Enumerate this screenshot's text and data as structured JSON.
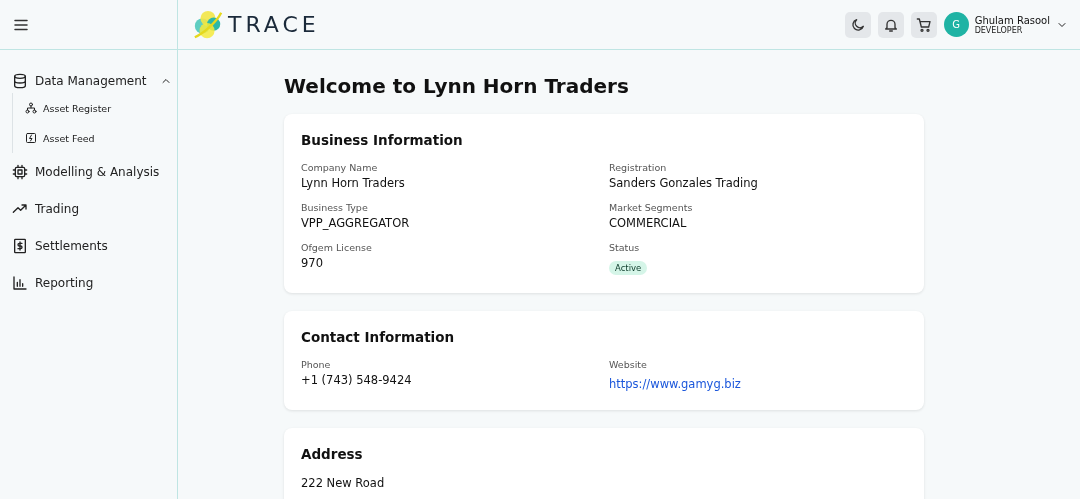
{
  "header": {
    "logo_text": "TRACE",
    "user": {
      "initial": "G",
      "name": "Ghulam Rasool",
      "role": "DEVELOPER"
    }
  },
  "sidebar": {
    "items": [
      {
        "label": "Data Management",
        "expanded": true,
        "children": [
          {
            "label": "Asset Register"
          },
          {
            "label": "Asset Feed"
          }
        ]
      },
      {
        "label": "Modelling & Analysis"
      },
      {
        "label": "Trading"
      },
      {
        "label": "Settlements"
      },
      {
        "label": "Reporting"
      }
    ]
  },
  "page_title": "Welcome to Lynn Horn Traders",
  "cards": [
    {
      "title": "Business Information",
      "fields": [
        {
          "label": "Company Name",
          "value": "Lynn Horn Traders",
          "kind": "text"
        },
        {
          "label": "Registration",
          "value": "Sanders Gonzales Trading",
          "kind": "text"
        },
        {
          "label": "Business Type",
          "value": "VPP_AGGREGATOR",
          "kind": "text"
        },
        {
          "label": "Market Segments",
          "value": "COMMERCIAL",
          "kind": "text"
        },
        {
          "label": "Ofgem License",
          "value": "970",
          "kind": "text"
        },
        {
          "label": "Status",
          "value": "Active",
          "kind": "badge"
        }
      ]
    },
    {
      "title": "Contact Information",
      "fields": [
        {
          "label": "Phone",
          "value": "+1 (743) 548-9424",
          "kind": "text"
        },
        {
          "label": "Website",
          "value": "https://www.gamyg.biz",
          "kind": "link"
        }
      ]
    },
    {
      "title": "Address",
      "lines": [
        "222 New Road"
      ]
    }
  ]
}
